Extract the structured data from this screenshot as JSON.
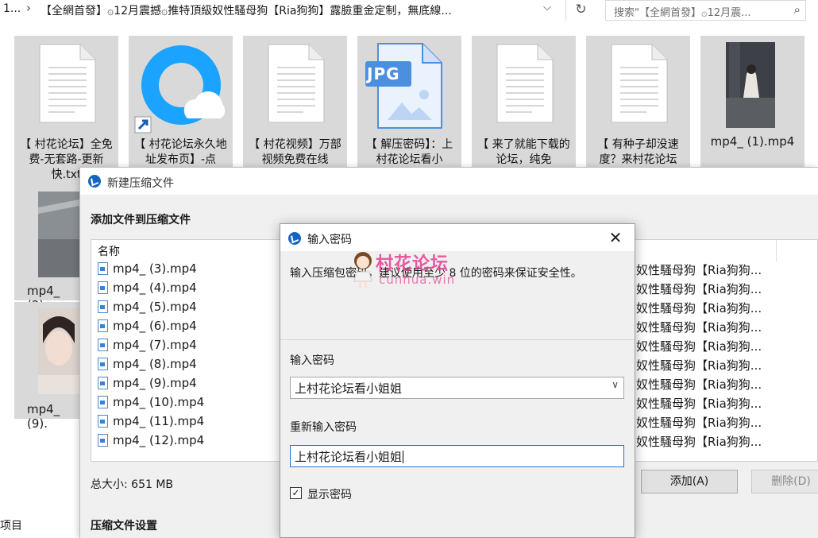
{
  "explorer": {
    "address_prefix": "1...",
    "address_path": "【全網首發】۞12月震撼۞推特頂級奴性騷母狗【Ria狗狗】露臉重金定制，無底線...",
    "search_placeholder": "搜索\"【全網首發】۞12月震...",
    "files": [
      {
        "label": "【 村花论坛】全免费-无套路-更新快.txt",
        "icon": "text-document-icon"
      },
      {
        "label": "【 村花论坛永久地址发布页】-点",
        "icon": "browser-shortcut-icon"
      },
      {
        "label": "【 村花视频】万部视频免费在线",
        "icon": "text-document-icon"
      },
      {
        "label": "【 解压密码】：上村花论坛看小",
        "icon": "jpg-file-icon",
        "badge": "JPG"
      },
      {
        "label": "【 来了就能下载的论坛，纯免",
        "icon": "text-document-icon"
      },
      {
        "label": "【 有种子却没速度？来村花论坛",
        "icon": "text-document-icon"
      },
      {
        "label": "mp4_ (1).mp4",
        "icon": "video-thumbnail-icon"
      }
    ],
    "side_tiles": [
      "mp4_ (2).",
      "mp4_ (9)."
    ],
    "left_cut_label": "项目"
  },
  "compress_window": {
    "title": "新建压缩文件",
    "heading": "添加文件到压缩文件",
    "column_name": "名称",
    "rows": [
      "mp4_ (3).mp4",
      "mp4_ (4).mp4",
      "mp4_ (5).mp4",
      "mp4_ (6).mp4",
      "mp4_ (7).mp4",
      "mp4_ (8).mp4",
      "mp4_ (9).mp4",
      "mp4_ (10).mp4",
      "mp4_ (11).mp4",
      "mp4_ (12).mp4"
    ],
    "row_path": "奴性騷母狗【Ria狗狗...",
    "total_size": "总大小: 651 MB",
    "add_button": "添加(A)",
    "delete_button": "删除(D)",
    "settings_heading": "压缩文件设置"
  },
  "password_dialog": {
    "title": "输入密码",
    "hint": "输入压缩包密码，建议使用至少 8 位的密码来保证安全性。",
    "password_label": "输入密码",
    "password_value": "上村花论坛看小姐姐",
    "reenter_label": "重新输入密码",
    "reenter_value": "上村花论坛看小姐姐",
    "show_password_label": "显示密码",
    "show_password_checked": "✓"
  },
  "watermark": {
    "text": "村花论坛",
    "url": "cunhua.win"
  },
  "colors": {
    "accent": "#1565c0",
    "selection_border": "#1c74d2",
    "tile_bg": "#d9d9d9",
    "dialog_bg": "#f0f0f0"
  }
}
